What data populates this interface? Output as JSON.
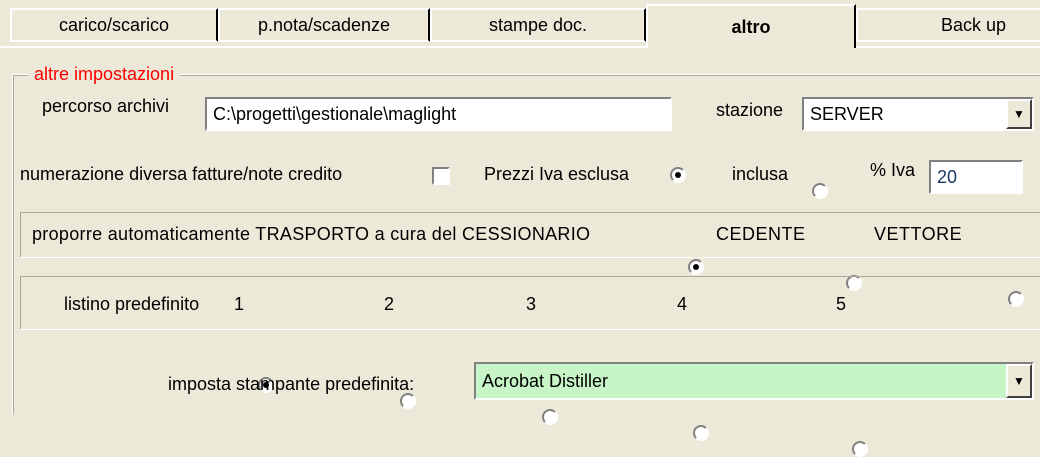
{
  "tabs": [
    {
      "label": "carico/scarico"
    },
    {
      "label": "p.nota/scadenze"
    },
    {
      "label": "stampe doc."
    },
    {
      "label": "altro"
    },
    {
      "label": "Back up"
    }
  ],
  "group_title": "altre impostazioni",
  "percorso": {
    "label": "percorso archivi",
    "value": "C:\\progetti\\gestionale\\maglight"
  },
  "stazione": {
    "label": "stazione",
    "value": "SERVER"
  },
  "numerazione": {
    "label": "numerazione diversa fatture/note credito",
    "checked": false
  },
  "prezzi": {
    "label": "Prezzi Iva esclusa",
    "inclusa_label": "inclusa",
    "selected": "esclusa"
  },
  "iva": {
    "label": "% Iva",
    "value": "20"
  },
  "trasporto": {
    "label": "proporre automaticamente TRASPORTO a cura del CESSIONARIO",
    "cedente_label": "CEDENTE",
    "vettore_label": "VETTORE",
    "selected": "CESSIONARIO"
  },
  "listino": {
    "label": "listino predefinito",
    "options": [
      "1",
      "2",
      "3",
      "4",
      "5"
    ],
    "selected": "1"
  },
  "stampante": {
    "label": "imposta stampante predefinita:",
    "value": "Acrobat Distiller",
    "bg_color": "#c8f5c8"
  }
}
